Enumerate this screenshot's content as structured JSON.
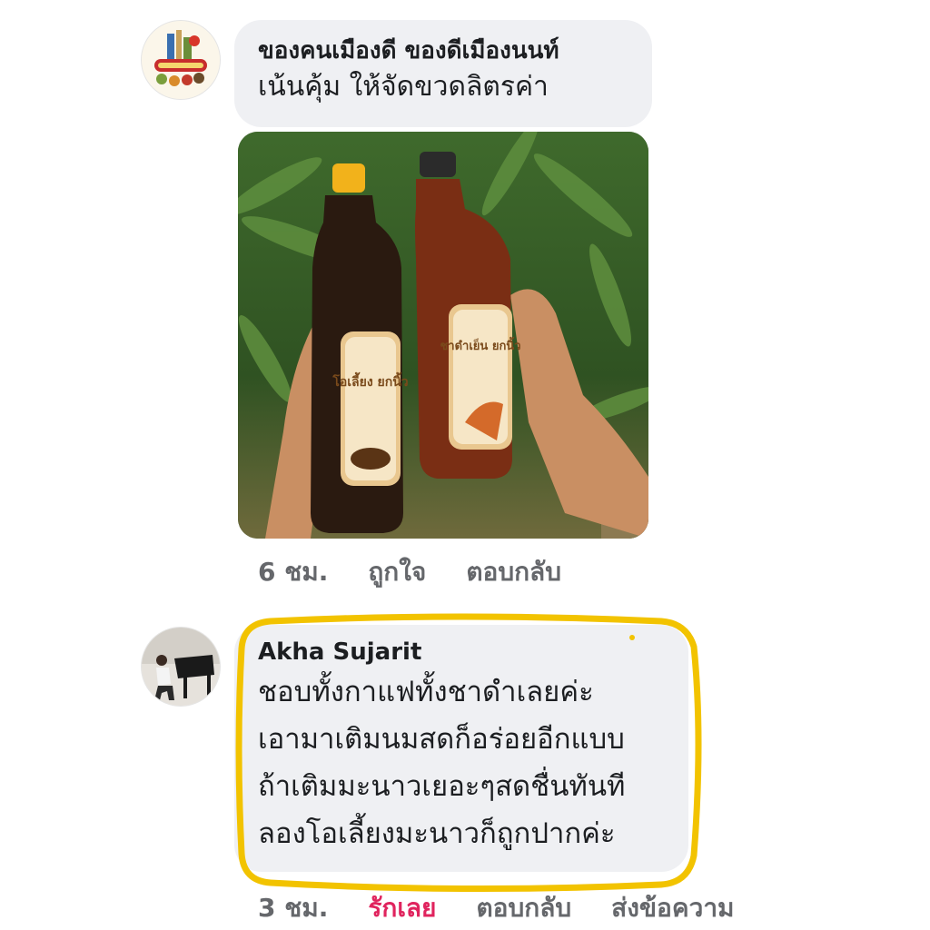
{
  "comment1": {
    "author": "ของคนเมืองดี ของดีเมืองนนท์",
    "text": "เน้นคุ้ม ให้จัดขวดลิตรค่า",
    "avatar_icon": "shop-logo-icon",
    "photo": {
      "bottle_left_label": "โอเลี้ยง ยกนิ้ว",
      "bottle_right_label": "ชาดำเย็น ยกนิ้ว"
    },
    "actions": {
      "time": "6 ชม.",
      "like": "ถูกใจ",
      "reply": "ตอบกลับ"
    }
  },
  "comment2": {
    "author": "Akha Sujarit",
    "avatar_icon": "piano-player-avatar-icon",
    "lines": [
      "ชอบทั้งกาแฟทั้งชาดำเลยค่ะ",
      "เอามาเติมนมสดก็อร่อยอีกแบบ",
      "ถ้าเติมมะนาวเยอะๆสดชื่นทันที",
      "ลองโอเลี้ยงมะนาวก็ถูกปากค่ะ"
    ],
    "actions": {
      "time": "3 ชม.",
      "love": "รักเลย",
      "reply": "ตอบกลับ",
      "message": "ส่งข้อความ"
    }
  },
  "colors": {
    "bubble": "#eff0f3",
    "meta": "#65676b",
    "love": "#e0245e",
    "highlight": "#f2c300"
  }
}
